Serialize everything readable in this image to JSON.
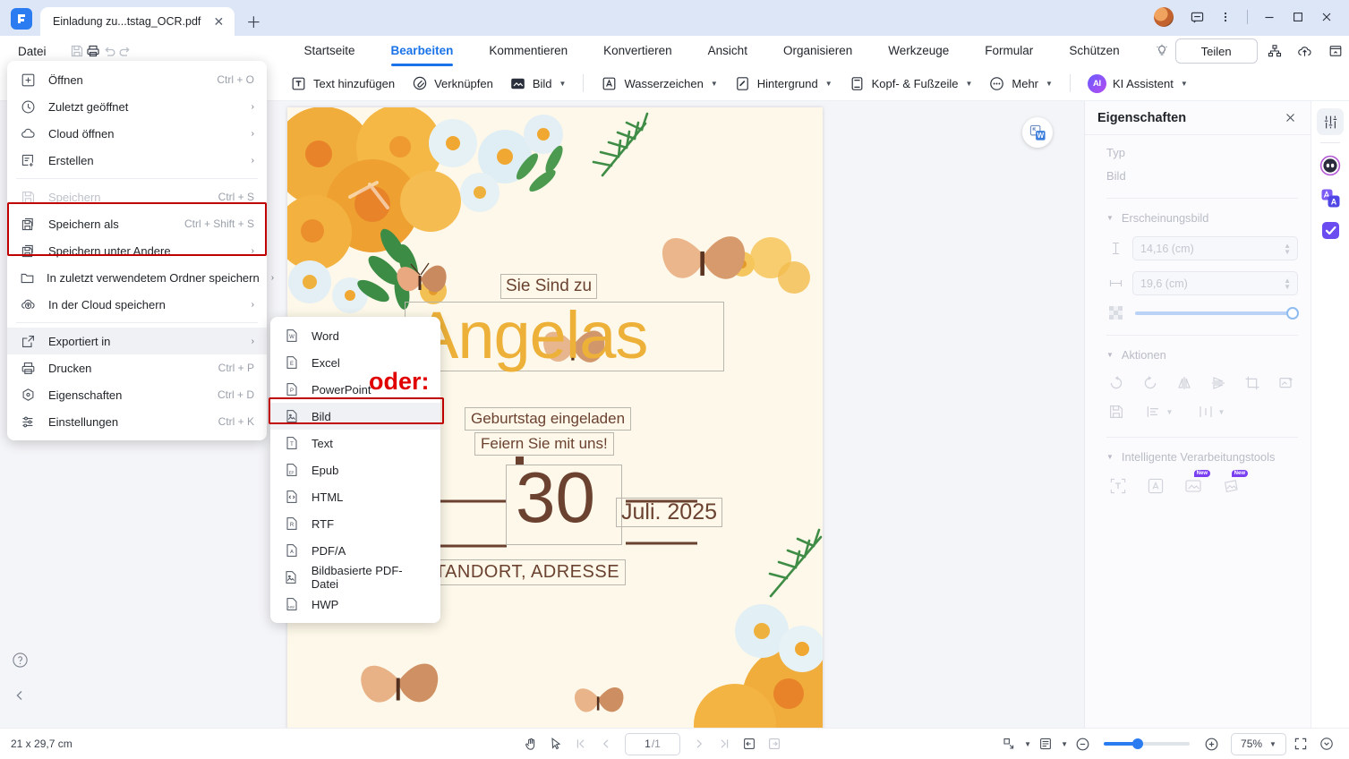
{
  "window": {
    "tab_title": "Einladung zu...tstag_OCR.pdf",
    "close_tab_icon": "close-icon",
    "new_tab_icon": "plus-icon",
    "minimize_icon": "minimize-icon",
    "maximize_icon": "maximize-icon",
    "close_icon": "close-icon",
    "comment_icon": "comment-icon",
    "more_icon": "more-vertical-icon"
  },
  "menubar": {
    "datei": "Datei",
    "quick_actions": [
      "save-icon",
      "print-icon",
      "undo-icon",
      "redo-icon"
    ],
    "tabs": [
      {
        "label": "Startseite",
        "selected": false
      },
      {
        "label": "Bearbeiten",
        "selected": true
      },
      {
        "label": "Kommentieren",
        "selected": false
      },
      {
        "label": "Konvertieren",
        "selected": false
      },
      {
        "label": "Ansicht",
        "selected": false
      },
      {
        "label": "Organisieren",
        "selected": false
      },
      {
        "label": "Werkzeuge",
        "selected": false
      },
      {
        "label": "Formular",
        "selected": false
      },
      {
        "label": "Schützen",
        "selected": false
      }
    ],
    "bulb_icon": "lightbulb-icon",
    "share_label": "Teilen",
    "right_icons": [
      "share-nodes-icon",
      "cloud-upload-icon",
      "collapse-ribbon-icon"
    ]
  },
  "ribbon": {
    "items": [
      {
        "label": "Text hinzufügen",
        "icon": "add-text-icon",
        "caret": false
      },
      {
        "label": "Verknüpfen",
        "icon": "link-icon",
        "caret": false
      },
      {
        "label": "Bild",
        "icon": "image-icon",
        "caret": true
      },
      {
        "label": "Wasserzeichen",
        "icon": "watermark-icon",
        "caret": true
      },
      {
        "label": "Hintergrund",
        "icon": "background-icon",
        "caret": true
      },
      {
        "label": "Kopf- & Fußzeile",
        "icon": "header-footer-icon",
        "caret": true
      },
      {
        "label": "Mehr",
        "icon": "more-dots-icon",
        "caret": true
      }
    ],
    "ai_badge": "AI",
    "ai_label": "KI Assistent"
  },
  "file_menu": {
    "items": [
      {
        "label": "Öffnen",
        "icon": "plus-box-icon",
        "shortcut": "Ctrl + O",
        "arrow": false,
        "disabled": false,
        "highlight": false
      },
      {
        "label": "Zuletzt geöffnet",
        "icon": "clock-icon",
        "shortcut": "",
        "arrow": true,
        "disabled": false,
        "highlight": false
      },
      {
        "label": "Cloud öffnen",
        "icon": "cloud-icon",
        "shortcut": "",
        "arrow": true,
        "disabled": false,
        "highlight": false
      },
      {
        "label": "Erstellen",
        "icon": "create-doc-icon",
        "shortcut": "",
        "arrow": true,
        "disabled": false,
        "highlight": false
      },
      {
        "label": "Speichern",
        "icon": "save-icon",
        "shortcut": "Ctrl + S",
        "arrow": false,
        "disabled": true,
        "highlight": false
      },
      {
        "label": "Speichern als",
        "icon": "save-as-icon",
        "shortcut": "Ctrl + Shift + S",
        "arrow": false,
        "disabled": false,
        "highlight": false
      },
      {
        "label": "Speichern unter Andere",
        "icon": "save-other-icon",
        "shortcut": "",
        "arrow": true,
        "disabled": false,
        "highlight": false
      },
      {
        "label": "In zuletzt verwendetem Ordner speichern",
        "icon": "folder-icon",
        "shortcut": "",
        "arrow": true,
        "disabled": false,
        "highlight": false
      },
      {
        "label": "In der Cloud speichern",
        "icon": "cloud-upload-icon",
        "shortcut": "",
        "arrow": true,
        "disabled": false,
        "highlight": false
      },
      {
        "label": "Exportiert in",
        "icon": "export-icon",
        "shortcut": "",
        "arrow": true,
        "disabled": false,
        "highlight": true
      },
      {
        "label": "Drucken",
        "icon": "print-icon",
        "shortcut": "Ctrl + P",
        "arrow": false,
        "disabled": false,
        "highlight": false
      },
      {
        "label": "Eigenschaften",
        "icon": "properties-icon",
        "shortcut": "Ctrl + D",
        "arrow": false,
        "disabled": false,
        "highlight": false
      },
      {
        "label": "Einstellungen",
        "icon": "settings-sliders-icon",
        "shortcut": "Ctrl + K",
        "arrow": false,
        "disabled": false,
        "highlight": false
      }
    ]
  },
  "export_submenu": {
    "items": [
      {
        "label": "Word",
        "icon": "word-file-icon",
        "highlight": false
      },
      {
        "label": "Excel",
        "icon": "excel-file-icon",
        "highlight": false
      },
      {
        "label": "PowerPoint",
        "icon": "powerpoint-file-icon",
        "highlight": false
      },
      {
        "label": "Bild",
        "icon": "image-file-icon",
        "highlight": true
      },
      {
        "label": "Text",
        "icon": "text-file-icon",
        "highlight": false
      },
      {
        "label": "Epub",
        "icon": "epub-file-icon",
        "highlight": false
      },
      {
        "label": "HTML",
        "icon": "html-file-icon",
        "highlight": false
      },
      {
        "label": "RTF",
        "icon": "rtf-file-icon",
        "highlight": false
      },
      {
        "label": "PDF/A",
        "icon": "pdfa-file-icon",
        "highlight": false
      },
      {
        "label": "Bildbasierte PDF-Datei",
        "icon": "image-pdf-file-icon",
        "highlight": false
      },
      {
        "label": "HWP",
        "icon": "hwp-file-icon",
        "highlight": false
      }
    ]
  },
  "annotation": {
    "oder": "oder:"
  },
  "document": {
    "line_sie": "Sie Sind zu",
    "name": "Angelas",
    "line_geb": "Geburtstag eingeladen",
    "line_feiern": "Feiern Sie mit uns!",
    "day": "30",
    "month_year": "Juli. 2025",
    "address": "STANDORT, ADRESSE",
    "convert_fab_icon": "convert-to-word-icon"
  },
  "properties_panel": {
    "title": "Eigenschaften",
    "close_icon": "close-icon",
    "type_label": "Typ",
    "type_value": "Bild",
    "appearance_label": "Erscheinungsbild",
    "height_value": "14,16 (cm)",
    "width_value": "19,6 (cm)",
    "height_icon": "height-icon",
    "width_icon": "width-icon",
    "opacity_icon": "opacity-checker-icon",
    "actions_label": "Aktionen",
    "action_icons": [
      "rotate-left-icon",
      "rotate-right-icon",
      "flip-horizontal-icon",
      "flip-vertical-icon",
      "crop-icon",
      "replace-image-icon",
      "save-image-icon",
      "align-icon",
      "distribute-icon"
    ],
    "smart_label": "Intelligente Verarbeitungstools",
    "smart_icons": [
      "ocr-text-icon",
      "translate-image-icon",
      "image-enhance-icon",
      "image-restore-icon"
    ],
    "new_badge": "New"
  },
  "icon_rail": {
    "items": [
      "properties-sliders-icon",
      "ai-robot-icon",
      "translate-icon",
      "checklist-icon"
    ]
  },
  "left_rail": {
    "help_icon": "help-circle-icon",
    "collapse_icon": "chevron-left-icon"
  },
  "statusbar": {
    "page_size": "21 x 29,7 cm",
    "hand_icon": "hand-tool-icon",
    "select_icon": "select-tool-icon",
    "first_page_icon": "first-page-icon",
    "prev_page_icon": "prev-page-icon",
    "page_current": "1",
    "page_total": "/1",
    "next_page_icon": "next-page-icon",
    "last_page_icon": "last-page-icon",
    "fit_width_icon": "fit-width-icon",
    "fit_page_icon": "fit-page-icon",
    "scroll_mode_icon": "scroll-mode-icon",
    "layout_mode_icon": "page-layout-icon",
    "zoom_out_icon": "zoom-out-icon",
    "zoom_in_icon": "zoom-in-icon",
    "zoom_value": "75%",
    "fullscreen_icon": "fullscreen-icon",
    "more_view_icon": "more-view-icon"
  }
}
